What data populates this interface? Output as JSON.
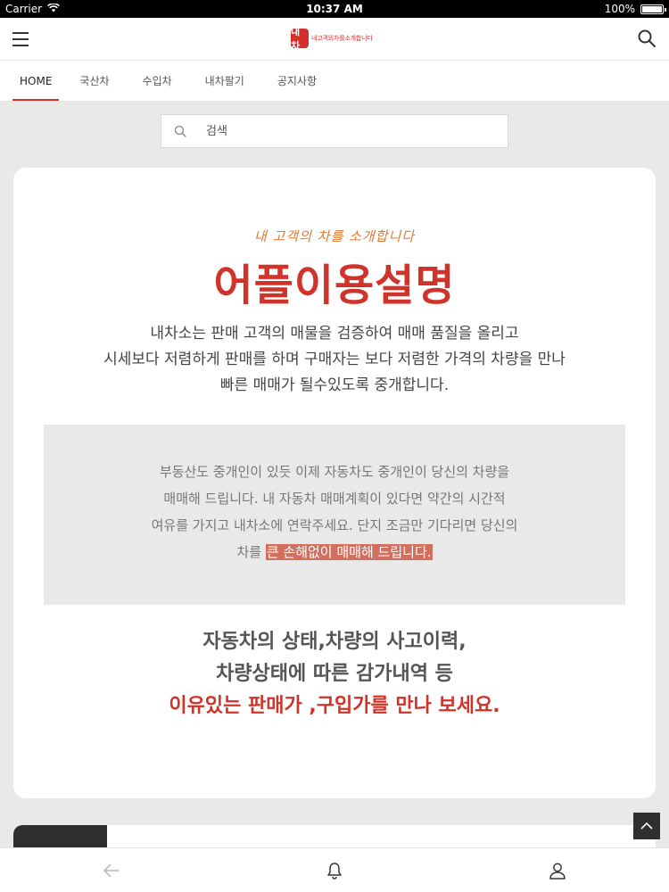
{
  "status_bar": {
    "carrier": "Carrier",
    "time": "10:37 AM",
    "battery": "100%"
  },
  "header": {
    "logo_mark": "내차",
    "logo_text": "내고객의차를소개합니다"
  },
  "tabs": [
    {
      "label": "HOME",
      "active": true
    },
    {
      "label": "국산차"
    },
    {
      "label": "수입차"
    },
    {
      "label": "내차팔기"
    },
    {
      "label": "공지사항"
    }
  ],
  "search": {
    "placeholder": "검색"
  },
  "intro": {
    "tagline": "내 고객의 차를 소개합니다",
    "title": "어플이용설명",
    "desc_lines": [
      "내차소는 판매 고객의 매물을 검증하여 매매 품질을 올리고",
      "시세보다 저렴하게 판매를 하며 구매자는 보다 저렴한 가격의 차량을 만나",
      "빠른 매매가 될수있도록 중개합니다."
    ]
  },
  "notice": {
    "lines": [
      "부동산도 중개인이 있듯 이제 자동차도 중개인이 당신의 차량을",
      "매매해 드립니다. 내 자동차 매매계획이 있다면 약간의 시간적",
      "여유를 가지고 내차소에 연락주세요. 단지 조금만 기다리면 당신의"
    ],
    "last_prefix": "차를 ",
    "last_highlight": "큰 손해없이 매매해 드립니다."
  },
  "headline": {
    "line1": "자동차의 상태,차량의 사고이력,",
    "line2": "차량상태에 따른 감가내역 등",
    "line3": "이유있는 판매가 ,구입가를 만나 보세요."
  },
  "colors": {
    "brand_red": "#d0332a",
    "tagline_orange": "#e27a34",
    "highlight": "#d1705f"
  }
}
